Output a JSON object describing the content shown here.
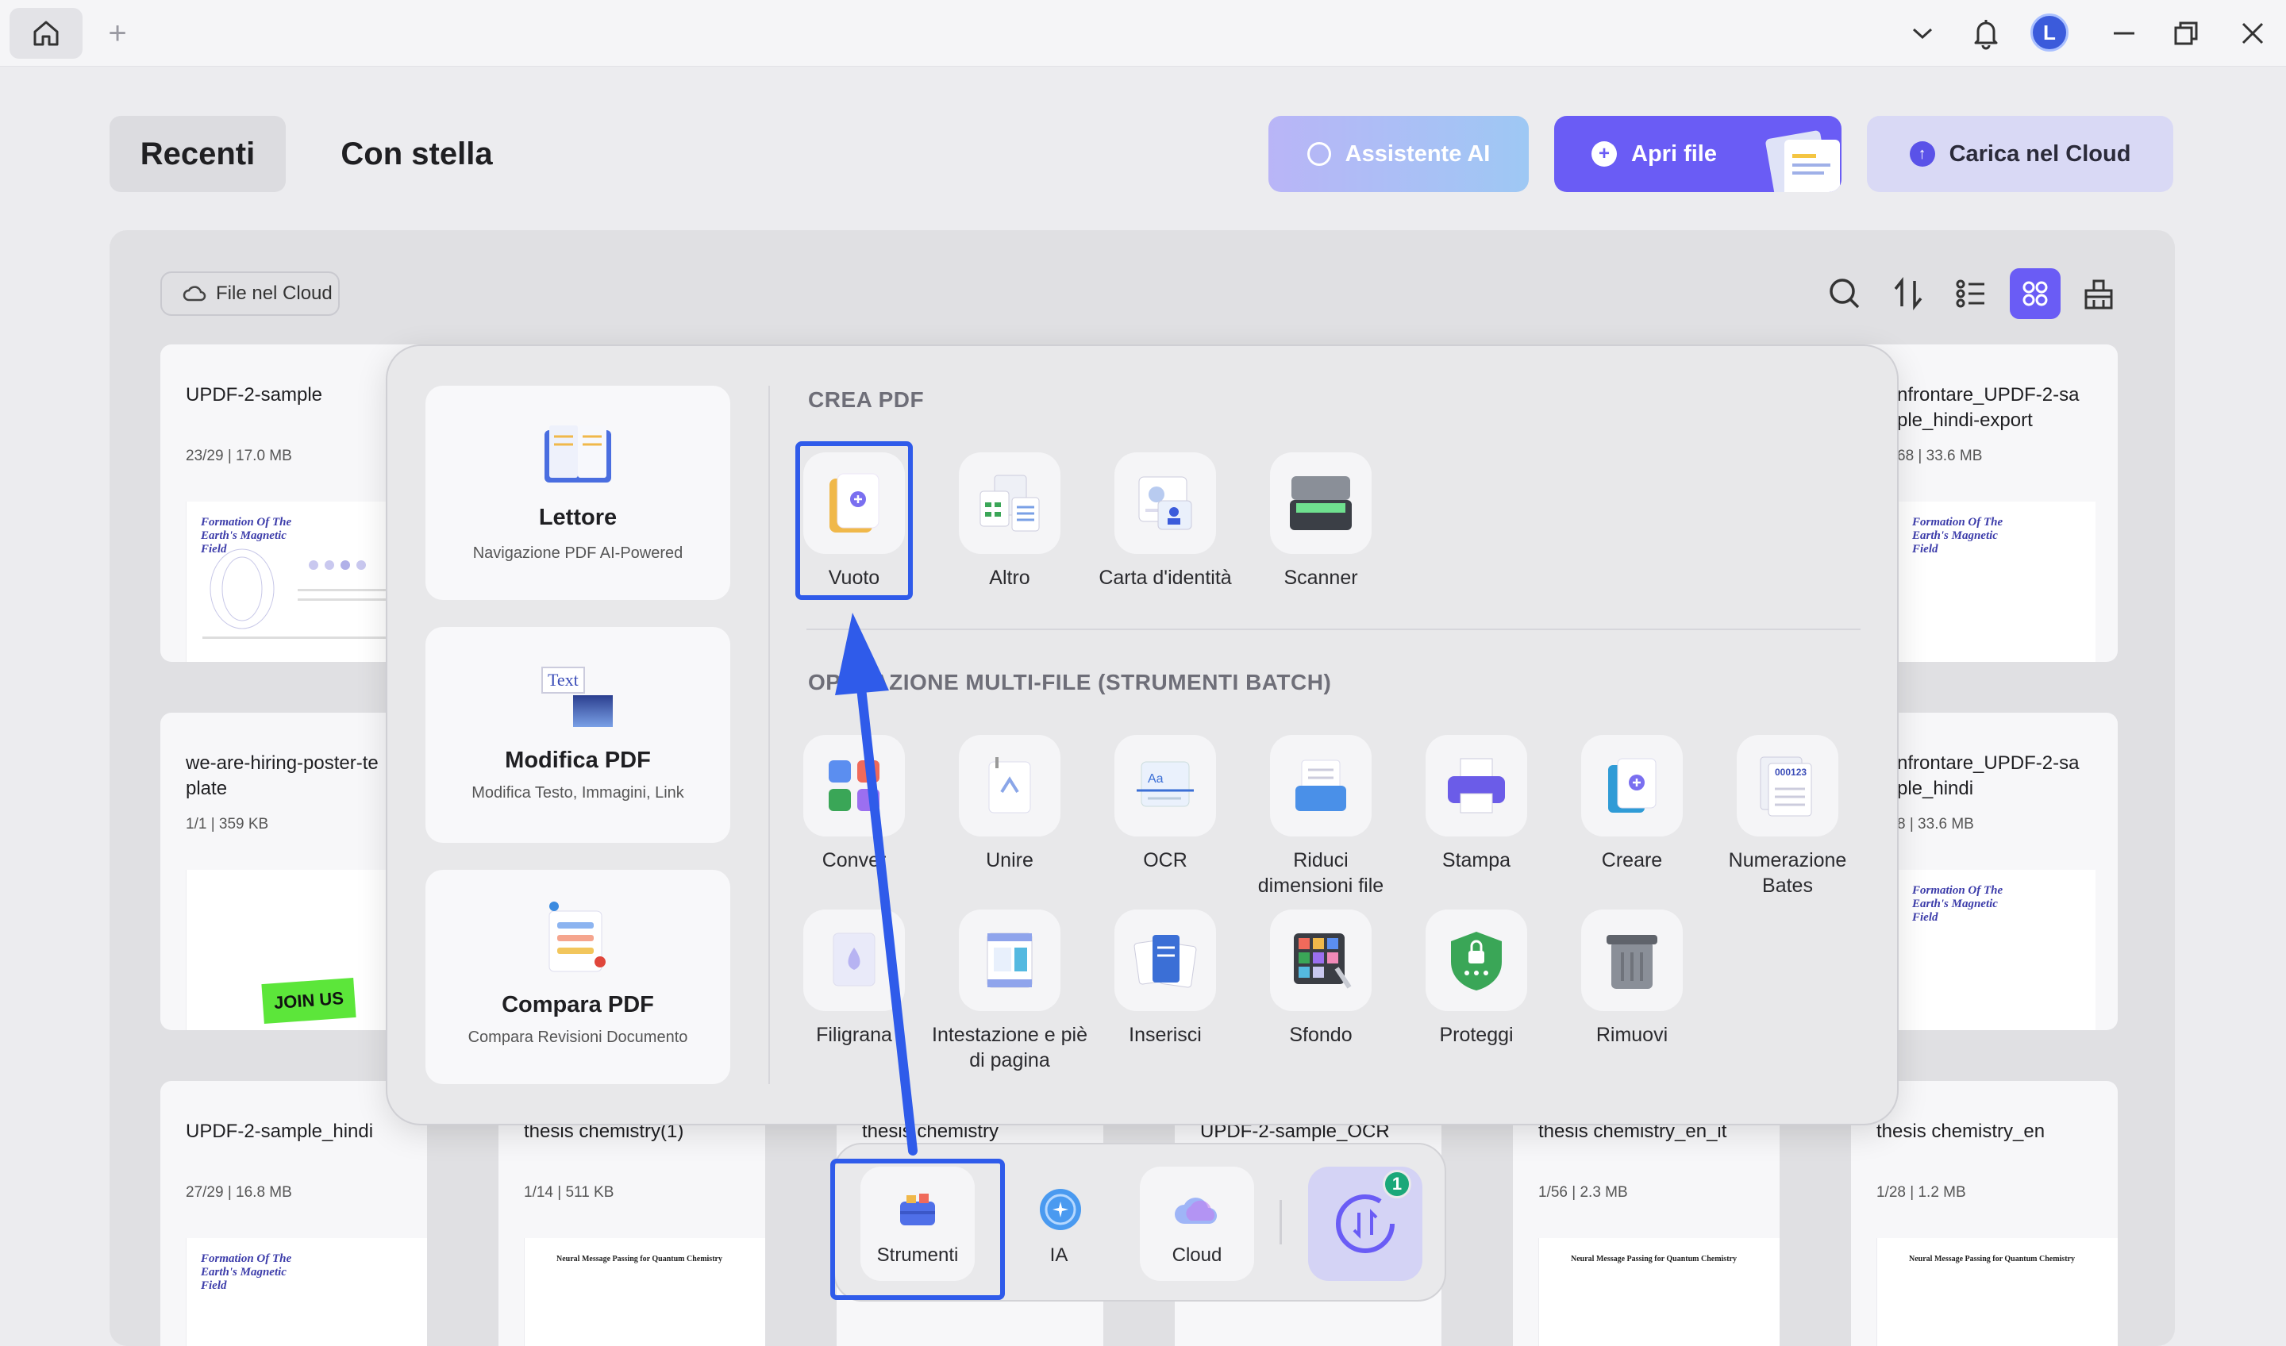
{
  "titlebar": {
    "avatar_letter": "L",
    "new_tab": "+"
  },
  "header": {
    "tabs": [
      "Recenti",
      "Con stella"
    ],
    "buttons": {
      "ai": "Assistente AI",
      "open": "Apri file",
      "cloud": "Carica nel Cloud"
    }
  },
  "toolbar": {
    "cloud_filter": "File nel Cloud"
  },
  "files": [
    {
      "name": "UPDF-2-sample",
      "meta": "23/29 | 17.0 MB",
      "thumb": "Formation Of The Earth's Magnetic Field"
    },
    {
      "name": "nfrontare_UPDF-2-sa\nple_hindi-export",
      "meta": "68 | 33.6 MB",
      "thumb": "Formation Of The Earth's Magnetic Field"
    },
    {
      "name": "we-are-hiring-poster-te\nplate",
      "meta": "1/1 | 359 KB",
      "thumb": "JOIN US"
    },
    {
      "name": "nfrontare_UPDF-2-sa\nple_hindi",
      "meta": "8 | 33.6 MB",
      "thumb": "Formation Of The Earth's Magnetic Field"
    },
    {
      "name": "UPDF-2-sample_hindi",
      "meta": "27/29 | 16.8 MB",
      "thumb": "Formation Of The Earth's Magnetic Field"
    },
    {
      "name": "thesis chemistry(1)",
      "meta": "1/14 | 511 KB",
      "thumb": "Neural Message Passing for Quantum Chemistry"
    },
    {
      "name": "thesis chemistry",
      "meta": "",
      "thumb": ""
    },
    {
      "name": "UPDF-2-sample_OCR",
      "meta": "",
      "thumb": ""
    },
    {
      "name": "thesis chemistry_en_it",
      "meta": "1/56 | 2.3 MB",
      "thumb": "Neural Message Passing for Quantum Chemistry"
    },
    {
      "name": "thesis chemistry_en",
      "meta": "1/28 | 1.2 MB",
      "thumb": "Neural Message Passing for Quantum Chemistry"
    }
  ],
  "tools_panel": {
    "left_cards": [
      {
        "title": "Lettore",
        "subtitle": "Navigazione PDF AI-Powered",
        "icon": "book-icon"
      },
      {
        "title": "Modifica PDF",
        "subtitle": "Modifica Testo, Immagini, Link",
        "icon": "text-image-icon",
        "icon_text": "Text"
      },
      {
        "title": "Compara PDF",
        "subtitle": "Compara Revisioni Documento",
        "icon": "compare-icon"
      }
    ],
    "create_section": {
      "heading": "CREA PDF",
      "items": [
        "Vuoto",
        "Altro",
        "Carta d'identità",
        "Scanner"
      ]
    },
    "batch_section": {
      "heading_visible_part": "ERAZIONE MULTI-FILE (STRUMENTI BATCH)",
      "heading_left_part": "OP",
      "row1": [
        "Conver",
        "Unire",
        "OCR",
        "Riduci\ndimensioni file",
        "Stampa",
        "Creare",
        "Numerazione\nBates"
      ],
      "row2": [
        "Filigrana",
        "Intestazione e piè\ndi pagina",
        "Inserisci",
        "Sfondo",
        "Proteggi",
        "Rimuovi"
      ],
      "bates_icon_text": "000123"
    }
  },
  "dock": {
    "items": [
      "Strumenti",
      "IA",
      "Cloud"
    ],
    "badge": "1"
  },
  "colors": {
    "accent": "#6a5cf5",
    "highlight": "#2f5bea",
    "badge": "#1aa879"
  }
}
